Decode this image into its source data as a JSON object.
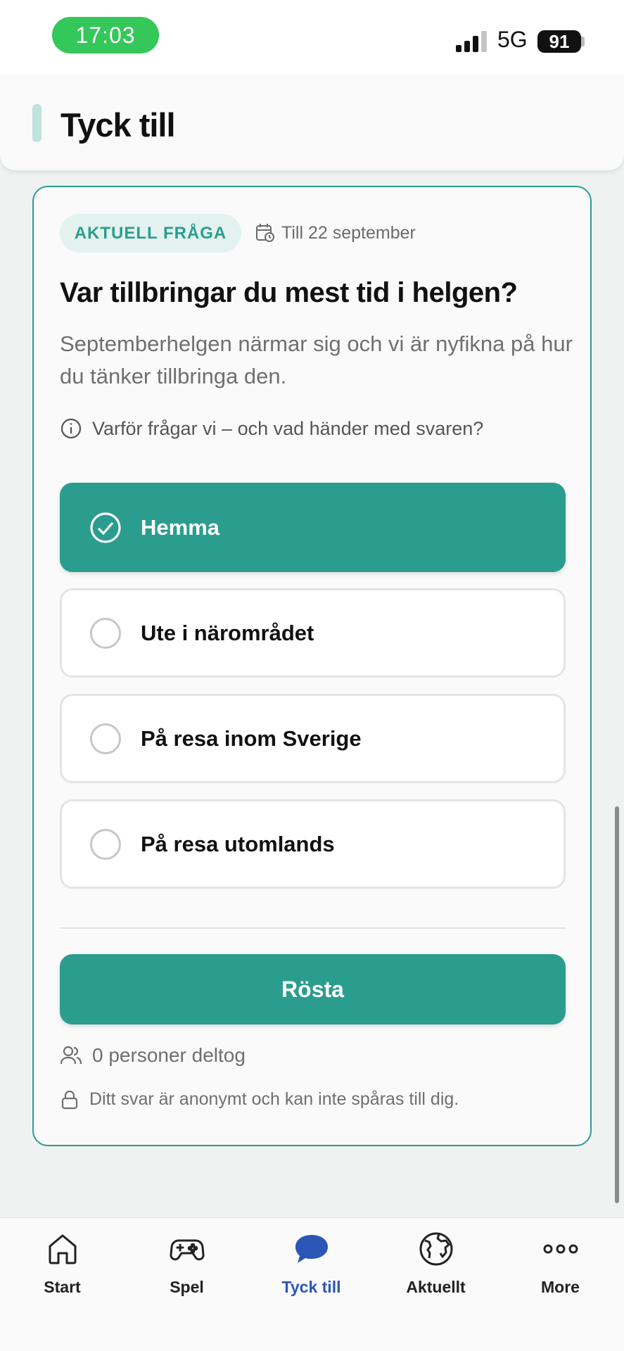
{
  "status_bar": {
    "time": "17:03",
    "network": "5G",
    "battery": "91"
  },
  "header": {
    "title": "Tyck till"
  },
  "card": {
    "tag": "AKTUELL FRÅGA",
    "deadline": "Till 22 september",
    "question": "Var tillbringar du mest tid i helgen?",
    "description": "Septemberhelgen närmar sig och vi är nyfikna på hur du tänker tillbringa den.",
    "info_link": "Varför frågar vi – och vad händer med svaren?",
    "options": [
      {
        "label": "Hemma",
        "selected": true
      },
      {
        "label": "Ute i närområdet",
        "selected": false
      },
      {
        "label": "På resa inom Sverige",
        "selected": false
      },
      {
        "label": "På resa utomlands",
        "selected": false
      }
    ],
    "vote_button": "Rösta",
    "participants": "0 personer deltog",
    "anonymous_note": "Ditt svar är anonymt och kan inte spåras till dig."
  },
  "bottom_nav": {
    "items": [
      {
        "label": "Start",
        "icon": "home-icon"
      },
      {
        "label": "Spel",
        "icon": "gamepad-icon"
      },
      {
        "label": "Tyck till",
        "icon": "chat-bubble-icon",
        "active": true
      },
      {
        "label": "Aktuellt",
        "icon": "globe-icon"
      },
      {
        "label": "More",
        "icon": "more-dots-icon"
      }
    ]
  },
  "colors": {
    "accent": "#2a9d8f",
    "tag_bg": "#e3f2ef",
    "nav_active": "#2b56b5",
    "time_pill": "#34c759"
  }
}
